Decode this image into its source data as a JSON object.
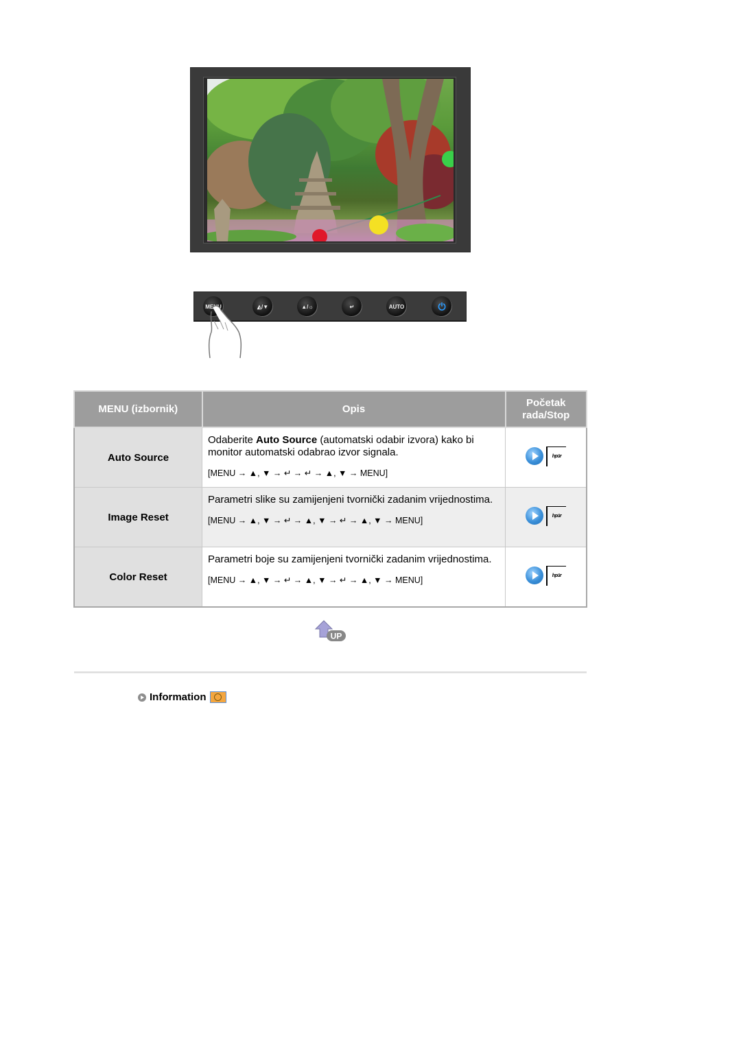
{
  "monitor_image": {
    "alt": "Monitor displaying a garden scene with a stone pagoda, trees and lanterns"
  },
  "control_buttons": [
    {
      "name": "menu",
      "label": "MENU"
    },
    {
      "name": "brightness-down",
      "label": "◭/▼"
    },
    {
      "name": "brightness-up",
      "label": "▲/☼"
    },
    {
      "name": "enter",
      "label": "↵"
    },
    {
      "name": "auto",
      "label": "AUTO"
    },
    {
      "name": "power",
      "label": "⏻"
    }
  ],
  "table": {
    "headers": {
      "menu": "MENU (izbornik)",
      "description": "Opis",
      "start_stop_line1": "Početak",
      "start_stop_line2": "rada/Stop"
    },
    "rows": [
      {
        "name": "Auto Source",
        "desc_prefix": "Odaberite ",
        "desc_bold": "Auto Source",
        "desc_suffix": " (automatski odabir izvora) kako bi monitor automatski odabrao izvor signala.",
        "path": "[MENU → ▲, ▼ → ↵ → ↵ → ▲, ▼ → MENU]"
      },
      {
        "name": "Image Reset",
        "desc": "Parametri slike su zamijenjeni tvornički zadanim vrijednostima.",
        "path": "[MENU → ▲, ▼ → ↵ → ▲, ▼ → ↵ → ▲, ▼ → MENU]"
      },
      {
        "name": "Color Reset",
        "desc": "Parametri boje su zamijenjeni tvornički zadanim vrijednostima.",
        "path": "[MENU → ▲, ▼ → ↵ → ▲, ▼ → ↵ → ▲, ▼ → MENU]"
      }
    ],
    "video_thumb_text": "hpür"
  },
  "up_button": {
    "label": "UP"
  },
  "info_link": {
    "label": "Information"
  },
  "colors": {
    "header_bg": "#9d9d9d",
    "name_cell_bg": "#e0e0e0",
    "alt_row_bg": "#eeeeee",
    "play_blue": "#3a8fd8",
    "power_blue": "#2a9bff"
  }
}
